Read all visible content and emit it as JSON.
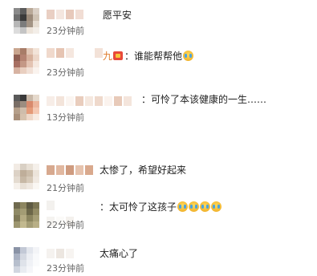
{
  "comments_top": [
    {
      "text": "愿平安",
      "time": "23分钟前",
      "name_suffix": ""
    },
    {
      "text": "谁能帮帮他",
      "time": "23分钟前",
      "name_suffix": "九",
      "has_badge": true,
      "emoji_count": 1
    },
    {
      "text": "可怜了本该健康的一生……",
      "time": "13分钟前",
      "name_suffix": "",
      "colon": "："
    }
  ],
  "comments_bottom": [
    {
      "text": "太惨了，希望好起来",
      "time": "21分钟前"
    },
    {
      "text": "太可怜了这孩子",
      "time": "22分钟前",
      "colon": "：",
      "emoji_count": 4
    },
    {
      "text": "太痛心了",
      "time": "23分钟前"
    }
  ],
  "colors": {
    "comment_text": "#222222",
    "time_text": "#666666",
    "badge": "#e8493a"
  },
  "icons": {
    "reaction": "loudly-crying-face-icon",
    "badge": "crown-badge-icon"
  }
}
